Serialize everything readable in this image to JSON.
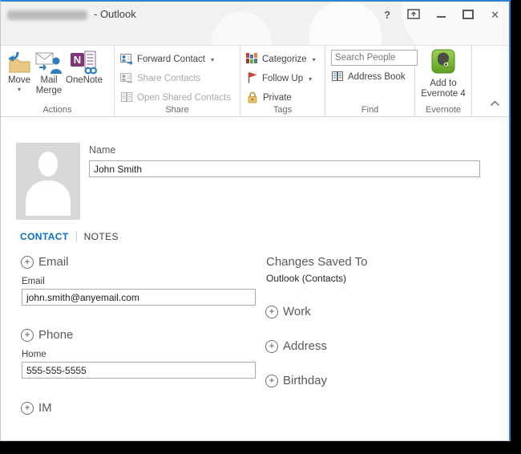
{
  "window": {
    "title": "- Outlook",
    "controls": {
      "help": "?",
      "close": "✕"
    }
  },
  "ribbon": {
    "groups": [
      {
        "label": "Actions"
      },
      {
        "label": "Share"
      },
      {
        "label": "Tags"
      },
      {
        "label": "Find"
      },
      {
        "label": "Evernote"
      }
    ],
    "actions": {
      "move": "Move",
      "mail_merge_line1": "Mail",
      "mail_merge_line2": "Merge",
      "onenote": "OneNote"
    },
    "share": {
      "forward_contact": "Forward Contact",
      "share_contacts": "Share Contacts",
      "open_shared_contacts": "Open Shared Contacts"
    },
    "tags": {
      "categorize": "Categorize",
      "follow_up": "Follow Up",
      "private": "Private"
    },
    "find": {
      "search_placeholder": "Search People",
      "address_book": "Address Book"
    },
    "evernote": {
      "line1": "Add to",
      "line2": "Evernote 4"
    }
  },
  "contact": {
    "name_label": "Name",
    "name_value": "John Smith",
    "tabs": {
      "contact": "CONTACT",
      "notes": "NOTES"
    },
    "email": {
      "section": "Email",
      "field_label": "Email",
      "value": "john.smith@anyemail.com"
    },
    "phone": {
      "section": "Phone",
      "field_label": "Home",
      "value": "555-555-5555"
    },
    "im": {
      "section": "IM"
    },
    "saved_to": {
      "label": "Changes Saved To",
      "value": "Outlook (Contacts)"
    },
    "work": {
      "section": "Work"
    },
    "address": {
      "section": "Address"
    },
    "birthday": {
      "section": "Birthday"
    }
  },
  "icons": {
    "plus": "+",
    "dropdown": "▾",
    "move": "folder-with-blue-arrow",
    "mail_merge": "envelope-with-person",
    "onenote": "onenote-purple-n",
    "forward_contact": "contact-card-arrow",
    "share_contacts": "contact-card-gray",
    "open_shared_contacts": "book-gray",
    "categorize": "color-squares-grid",
    "follow_up": "red-flag",
    "private": "gold-lock",
    "address_book": "book-colored",
    "evernote": "green-elephant",
    "collapse_ribbon": "chevron-up"
  },
  "colors": {
    "accent_blue": "#0a6fc2",
    "window_border": "#2a84d8",
    "evernote_green": "#76b82a",
    "flag_red": "#cf4332",
    "lock_gold": "#ecc36d",
    "onenote_purple": "#7e3878"
  }
}
